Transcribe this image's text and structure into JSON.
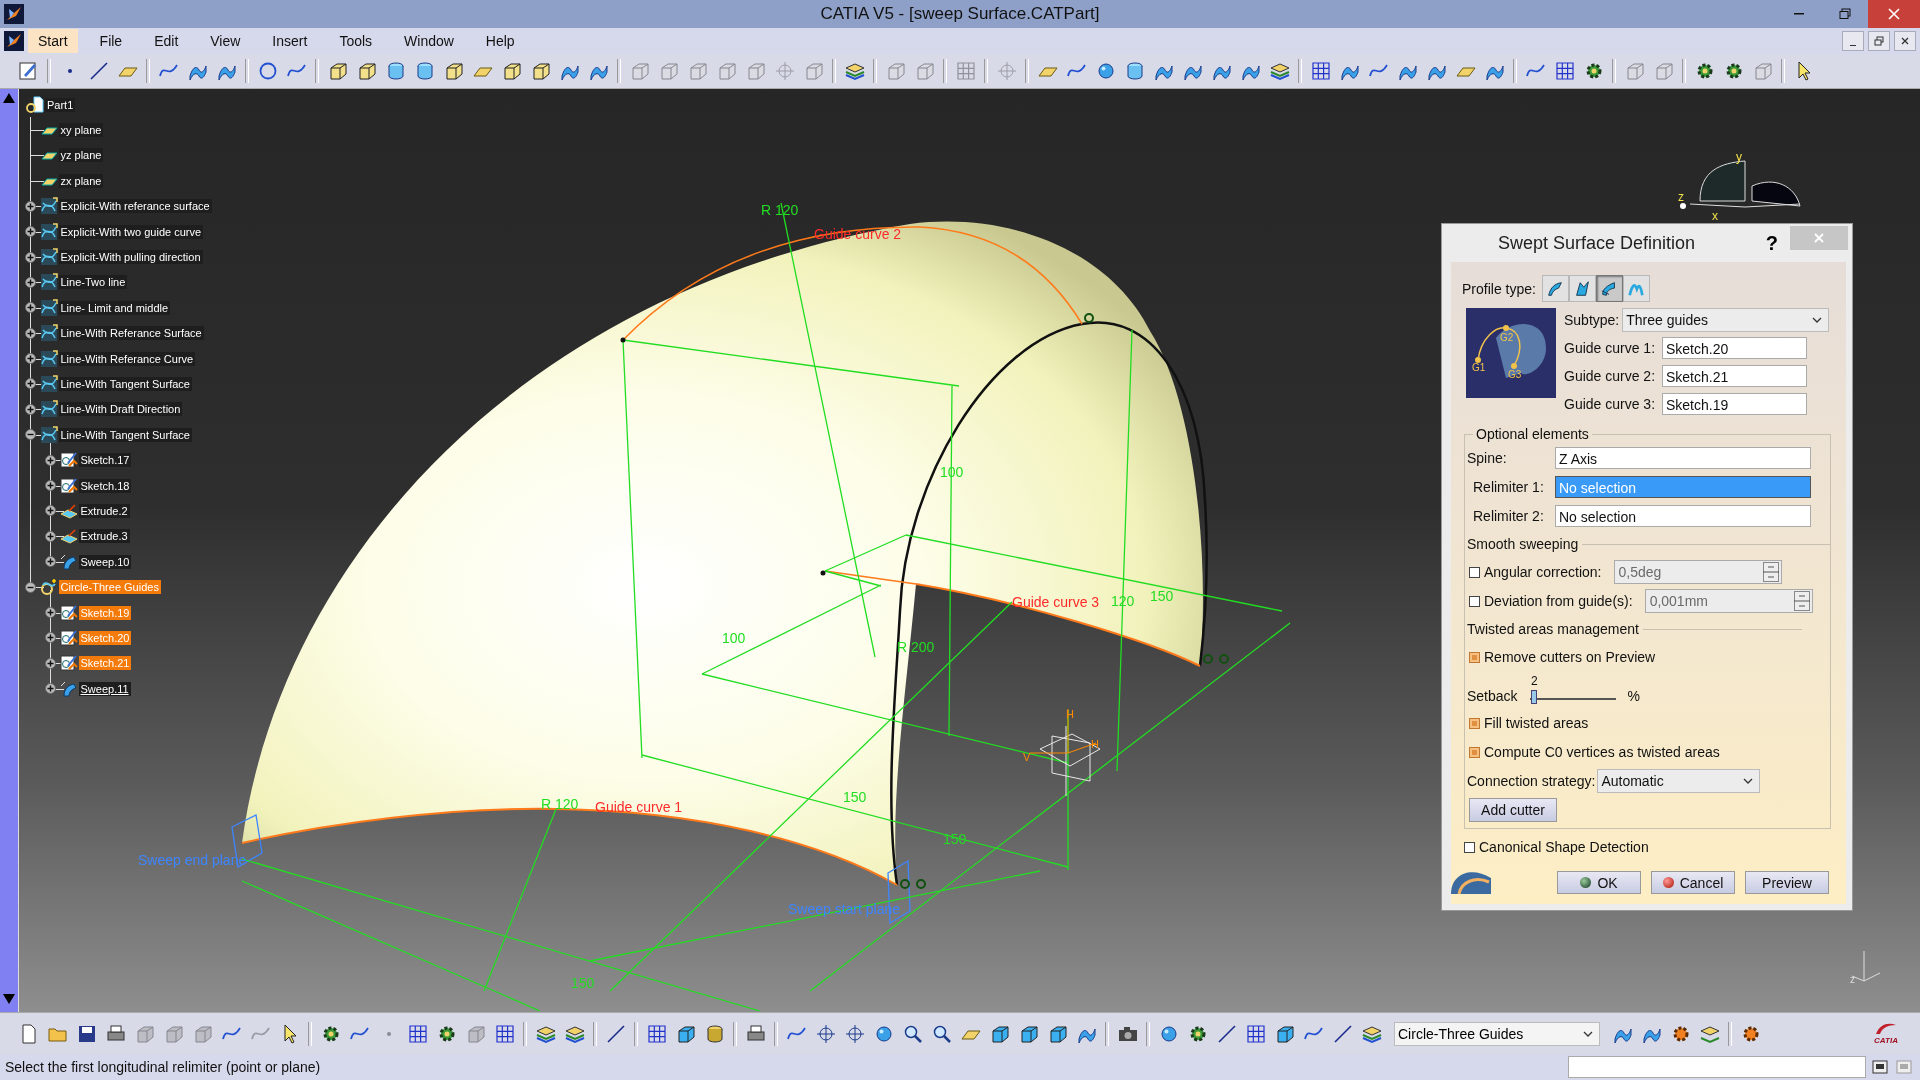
{
  "window": {
    "title": "CATIA V5 - [sweep Surface.CATPart]"
  },
  "menu": [
    {
      "label": "Start",
      "selected": true
    },
    {
      "label": "File",
      "selected": false
    },
    {
      "label": "Edit",
      "selected": false
    },
    {
      "label": "View",
      "selected": false
    },
    {
      "label": "Insert",
      "selected": false
    },
    {
      "label": "Tools",
      "selected": false
    },
    {
      "label": "Window",
      "selected": false
    },
    {
      "label": "Help",
      "selected": false
    }
  ],
  "tree": {
    "label": "Part1",
    "kind": "part",
    "children": [
      {
        "label": "xy plane",
        "kind": "plane",
        "selected": false,
        "current": false
      },
      {
        "label": "yz plane",
        "kind": "plane",
        "selected": false,
        "current": false
      },
      {
        "label": "zx plane",
        "kind": "plane",
        "selected": false,
        "current": false
      },
      {
        "label": "Explicit-With referance surface",
        "kind": "set",
        "expanded": false,
        "selected": false,
        "current": false
      },
      {
        "label": "Explicit-With two guide curve",
        "kind": "set",
        "expanded": false,
        "selected": false,
        "current": false
      },
      {
        "label": "Explicit-With pulling direction",
        "kind": "set",
        "expanded": false,
        "selected": false,
        "current": false
      },
      {
        "label": "Line-Two line",
        "kind": "set",
        "expanded": false,
        "selected": false,
        "current": false
      },
      {
        "label": "Line- Limit and middle",
        "kind": "set",
        "expanded": false,
        "selected": false,
        "current": false
      },
      {
        "label": "Line-With Referance Surface",
        "kind": "set",
        "expanded": false,
        "selected": false,
        "current": false
      },
      {
        "label": "Line-With Referance Curve",
        "kind": "set",
        "expanded": false,
        "selected": false,
        "current": false
      },
      {
        "label": "Line-With Tangent Surface",
        "kind": "set",
        "expanded": false,
        "selected": false,
        "current": false
      },
      {
        "label": "Line-With Draft Direction",
        "kind": "set",
        "expanded": false,
        "selected": false,
        "current": false
      },
      {
        "label": "Line-With Tangent Surface",
        "kind": "set",
        "expanded": true,
        "selected": false,
        "current": false,
        "children": [
          {
            "label": "Sketch.17",
            "kind": "sketch",
            "expanded": false,
            "selected": false,
            "current": false
          },
          {
            "label": "Sketch.18",
            "kind": "sketch",
            "expanded": false,
            "selected": false,
            "current": false
          },
          {
            "label": "Extrude.2",
            "kind": "extrude",
            "expanded": false,
            "selected": false,
            "current": false
          },
          {
            "label": "Extrude.3",
            "kind": "extrude",
            "expanded": false,
            "selected": false,
            "current": false
          },
          {
            "label": "Sweep.10",
            "kind": "sweep",
            "expanded": false,
            "selected": false,
            "current": false
          }
        ]
      },
      {
        "label": "Circle-Three Guides",
        "kind": "active_set",
        "expanded": true,
        "selected": true,
        "current": false,
        "children": [
          {
            "label": "Sketch.19",
            "kind": "sketch",
            "expanded": false,
            "selected": true,
            "current": false
          },
          {
            "label": "Sketch.20",
            "kind": "sketch",
            "expanded": false,
            "selected": true,
            "current": false
          },
          {
            "label": "Sketch.21",
            "kind": "sketch",
            "expanded": false,
            "selected": true,
            "current": false
          },
          {
            "label": "Sweep.11",
            "kind": "sweep",
            "expanded": false,
            "selected": false,
            "current": true
          }
        ]
      }
    ]
  },
  "canvas": {
    "labels": [
      {
        "text": "R 120",
        "kind": "dimension"
      },
      {
        "text": "Guide curve 2",
        "kind": "guide"
      },
      {
        "text": "100",
        "kind": "dimension"
      },
      {
        "text": "150",
        "kind": "dimension"
      },
      {
        "text": "Guide curve 3",
        "kind": "guide"
      },
      {
        "text": "120",
        "kind": "dimension"
      },
      {
        "text": "R 200",
        "kind": "dimension"
      },
      {
        "text": "100",
        "kind": "dimension"
      },
      {
        "text": "150",
        "kind": "dimension"
      },
      {
        "text": "150",
        "kind": "dimension"
      },
      {
        "text": "R 120",
        "kind": "dimension"
      },
      {
        "text": "Guide curve 1",
        "kind": "guide"
      },
      {
        "text": "Sweep end plane",
        "kind": "plane"
      },
      {
        "text": "Sweep start plane",
        "kind": "plane"
      },
      {
        "text": "150",
        "kind": "dimension"
      },
      {
        "text": "H",
        "kind": "axis"
      },
      {
        "text": "H",
        "kind": "axis"
      },
      {
        "text": "V",
        "kind": "axis"
      }
    ],
    "compass": [
      "y",
      "z",
      "x"
    ],
    "small_axis": [
      "z"
    ]
  },
  "dialog": {
    "title": "Swept Surface Definition",
    "help": "?",
    "profile_type": {
      "label": "Profile type:",
      "options": [
        {
          "selected": false
        },
        {
          "selected": false
        },
        {
          "selected": true
        },
        {
          "selected": false
        }
      ]
    },
    "diagram_labels": [
      "G1",
      "G2",
      "G3"
    ],
    "subtype": {
      "label": "Subtype:",
      "value": "Three guides"
    },
    "guides": [
      {
        "label": "Guide curve 1:",
        "value": "Sketch.20"
      },
      {
        "label": "Guide curve 2:",
        "value": "Sketch.21"
      },
      {
        "label": "Guide curve 3:",
        "value": "Sketch.19"
      }
    ],
    "optional": {
      "legend": "Optional elements",
      "fields": [
        {
          "label": "Spine:",
          "value": "Z Axis",
          "selected": false
        },
        {
          "label": "Relimiter 1:",
          "value": "No selection",
          "selected": true
        },
        {
          "label": "Relimiter 2:",
          "value": "No selection",
          "selected": false
        }
      ],
      "smooth": {
        "heading": "Smooth sweeping",
        "options": [
          {
            "label": "Angular correction:",
            "checked": false,
            "value": "0,5deg",
            "disabled": true
          },
          {
            "label": "Deviation from guide(s):",
            "checked": false,
            "value": "0,001mm",
            "disabled": true
          }
        ]
      },
      "twisted": {
        "heading": "Twisted areas management",
        "remove_cutters": {
          "label": "Remove cutters on Preview",
          "checked": true
        },
        "setback": {
          "label": "Setback",
          "value": "2",
          "unit": "%",
          "level": 0.05
        },
        "fill": {
          "label": "Fill twisted areas",
          "checked": true
        },
        "compute": {
          "label": "Compute C0 vertices as twisted areas",
          "checked": true
        },
        "connection": {
          "label": "Connection strategy:",
          "value": "Automatic"
        },
        "add_cutter": "Add cutter"
      }
    },
    "canonical": {
      "label": "Canonical Shape Detection",
      "checked": false
    },
    "buttons": [
      {
        "label": "OK",
        "kind": "ok"
      },
      {
        "label": "Cancel",
        "kind": "cancel"
      },
      {
        "label": "Preview",
        "kind": "preview"
      }
    ]
  },
  "bottom_toolbar": {
    "workbench_select": "Circle-Three Guides",
    "logo_text": "CATIA"
  },
  "status_bar": {
    "message": "Select the first longitudinal relimiter (point or plane)"
  }
}
